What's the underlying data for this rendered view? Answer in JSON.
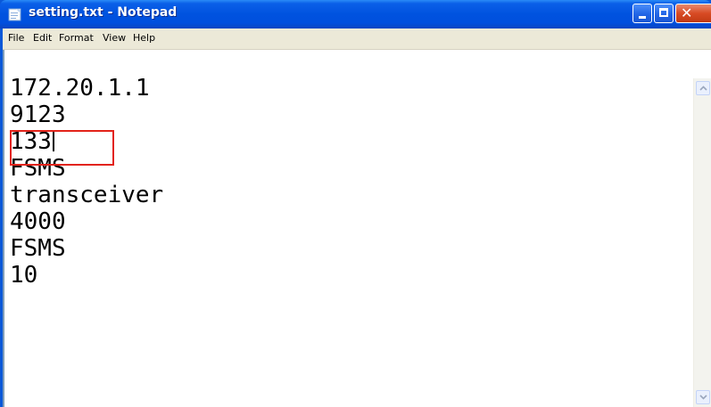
{
  "window": {
    "title": "setting.txt - Notepad",
    "close_glyph": "✕"
  },
  "menu": [
    "File",
    "Edit",
    "Format",
    "View",
    "Help"
  ],
  "editor": {
    "lines": [
      "172.20.1.1",
      "9123",
      "133",
      "FSMS",
      "transceiver",
      "4000",
      "FSMS",
      "10"
    ],
    "caret_line": 3
  },
  "colors": {
    "titlebar": "#0052df",
    "highlight_border": "#e2231a",
    "menubar": "#ece9d8"
  },
  "icons": [
    "notepad-app-icon",
    "minimize-icon",
    "maximize-icon",
    "close-icon",
    "scroll-up-arrow-icon",
    "scroll-down-arrow-icon"
  ]
}
